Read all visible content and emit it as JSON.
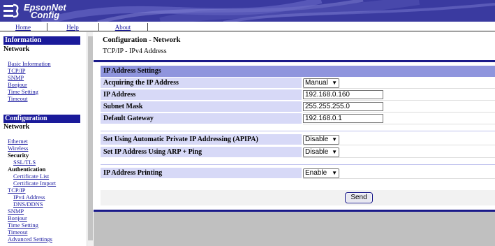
{
  "header": {
    "logo_line1": "EpsonNet",
    "logo_line2": "Config",
    "colors": {
      "header_bg": "#3a3aa0",
      "accent": "#1a1a9a",
      "section_bg": "#8f95dd",
      "label_bg": "#d7d9f7"
    }
  },
  "nav": {
    "home": "Home",
    "help": "Help",
    "about": "About"
  },
  "sidebar": {
    "information_heading": "Information",
    "information_sub": "Network",
    "information_links": [
      "Basic Information",
      "TCP/IP",
      "SNMP",
      "Bonjour",
      "Time Setting",
      "Timeout"
    ],
    "configuration_heading": "Configuration",
    "configuration_sub": "Network",
    "config_items": {
      "ethernet": "Ethernet",
      "wireless": "Wireless",
      "security": "Security",
      "ssl_tls": "SSL/TLS",
      "authentication": "Authentication",
      "certificate_list": "Certificate List",
      "certificate_import": "Certificate Import",
      "tcp_ip": "TCP/IP",
      "ipv4_address": "IPv4 Address",
      "dns_ddns": "DNS/DDNS",
      "snmp": "SNMP",
      "bonjour": "Bonjour",
      "time_setting": "Time Setting",
      "timeout": "Timeout",
      "advanced_settings": "Advanced Settings"
    }
  },
  "main": {
    "title": "Configuration - Network",
    "subtitle": "TCP/IP - IPv4 Address",
    "section_header": "IP Address Settings",
    "rows": {
      "acquiring_label": "Acquiring the IP Address",
      "acquiring_value": "Manual",
      "ip_label": "IP Address",
      "ip_value": "192.168.0.160",
      "subnet_label": "Subnet Mask",
      "subnet_value": "255.255.255.0",
      "gateway_label": "Default Gateway",
      "gateway_value": "192.168.0.1",
      "apipa_label": "Set Using Automatic Private IP Addressing (APIPA)",
      "apipa_value": "Disable",
      "arp_label": "Set IP Address Using ARP + Ping",
      "arp_value": "Disable",
      "printing_label": "IP Address Printing",
      "printing_value": "Enable"
    },
    "send_label": "Send"
  }
}
